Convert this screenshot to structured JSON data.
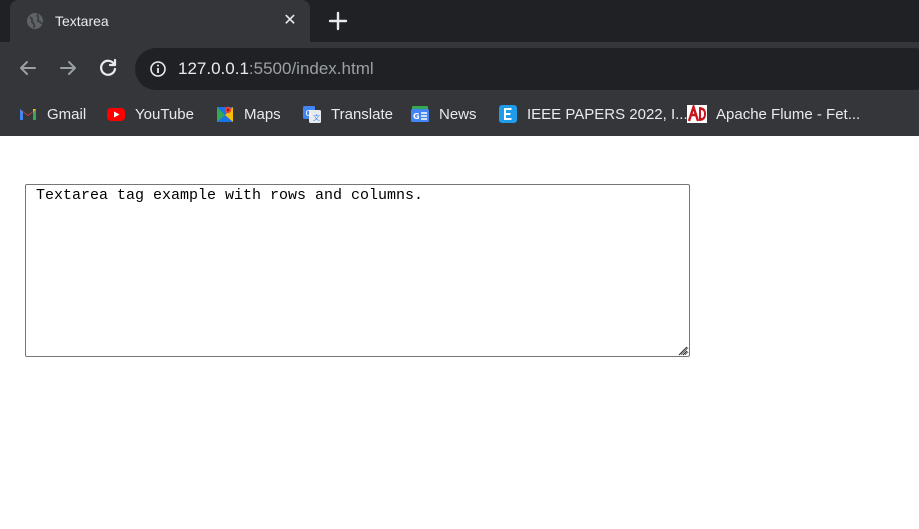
{
  "browser": {
    "tab": {
      "title": "Textarea",
      "close_label": "✕"
    },
    "address": {
      "host": "127.0.0.1",
      "path": ":5500/index.html"
    },
    "bookmarks": [
      {
        "label": "Gmail",
        "icon": "gmail-icon"
      },
      {
        "label": "YouTube",
        "icon": "youtube-icon"
      },
      {
        "label": "Maps",
        "icon": "maps-icon"
      },
      {
        "label": "Translate",
        "icon": "translate-icon"
      },
      {
        "label": "News",
        "icon": "news-icon"
      },
      {
        "label": "IEEE PAPERS 2022, I...",
        "icon": "e-letter-icon"
      },
      {
        "label": "Apache Flume - Fet...",
        "icon": "ad-icon"
      }
    ]
  },
  "page": {
    "textarea": {
      "value": "Textarea tag example with rows and columns."
    }
  },
  "colors": {
    "tabstrip": "#202124",
    "toolbar": "#35363a",
    "text_light": "#e8eaed",
    "text_dim": "#9aa0a6"
  }
}
